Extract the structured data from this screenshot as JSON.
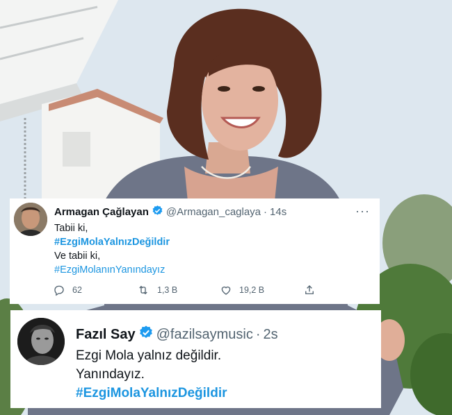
{
  "tweets": [
    {
      "name": "Armagan Çağlayan",
      "handle": "@Armagan_caglaya",
      "separator": "·",
      "time": "14s",
      "more": "···",
      "lines": [
        {
          "text": "Tabii ki,",
          "type": "text"
        },
        {
          "text": "#EzgiMolaYalnızDeğildir",
          "type": "hashtag-bold"
        },
        {
          "text": "Ve tabii ki,",
          "type": "text"
        },
        {
          "text": "#EzgiMolanınYanındayız",
          "type": "hashtag"
        }
      ],
      "actions": {
        "reply_icon": "reply-icon",
        "reply_count": "62",
        "retweet_icon": "retweet-icon",
        "retweet_count": "1,3 B",
        "like_icon": "heart-icon",
        "like_count": "19,2 B",
        "share_icon": "share-icon"
      }
    },
    {
      "name": "Fazıl Say",
      "handle": "@fazilsaymusic",
      "separator": "·",
      "time": "2s",
      "lines": [
        {
          "text": "Ezgi Mola yalnız değildir.",
          "type": "text"
        },
        {
          "text": "Yanındayız.",
          "type": "text"
        },
        {
          "text": "#EzgiMolaYalnızDeğildir",
          "type": "hashtag-bold"
        }
      ]
    }
  ],
  "colors": {
    "link": "#1b95e0",
    "verified": "#1d9bf0",
    "secondary": "#536471",
    "text": "#0f1419"
  }
}
